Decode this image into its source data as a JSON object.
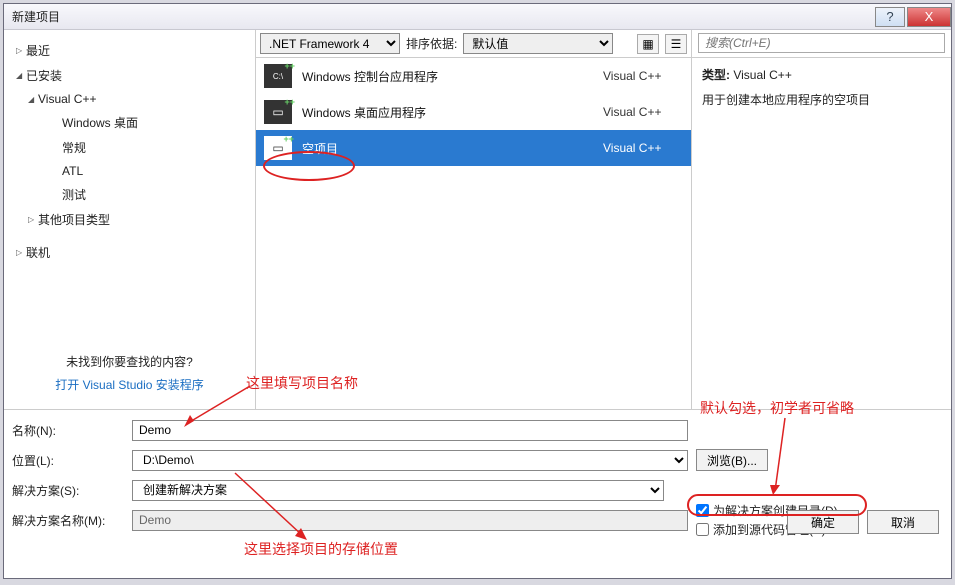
{
  "window_title": "新建项目",
  "titlebar": {
    "help": "?",
    "close": "X"
  },
  "tree": {
    "recent": "最近",
    "installed": "已安装",
    "vcpp": "Visual C++",
    "win_desktop": "Windows 桌面",
    "general": "常规",
    "atl": "ATL",
    "test": "测试",
    "other_types": "其他项目类型",
    "online": "联机"
  },
  "left_bottom": {
    "not_found": "未找到你要查找的内容?",
    "open_installer": "打开 Visual Studio 安装程序"
  },
  "toolbar": {
    "framework": ".NET Framework 4",
    "sort_label": "排序依据:",
    "sort_value": "默认值"
  },
  "templates": [
    {
      "name": "Windows 控制台应用程序",
      "lang": "Visual C++",
      "icon": "C:\\"
    },
    {
      "name": "Windows 桌面应用程序",
      "lang": "Visual C++",
      "icon": "▭"
    },
    {
      "name": "空项目",
      "lang": "Visual C++",
      "icon": "▭"
    }
  ],
  "search": {
    "placeholder": "搜索(Ctrl+E)"
  },
  "detail": {
    "type_label": "类型:",
    "type_value": "Visual C++",
    "description": "用于创建本地应用程序的空项目"
  },
  "form": {
    "name_label": "名称(N):",
    "name_value": "Demo",
    "loc_label": "位置(L):",
    "loc_value": "D:\\Demo\\",
    "browse": "浏览(B)...",
    "sln_label": "解决方案(S):",
    "sln_value": "创建新解决方案",
    "sln_name_label": "解决方案名称(M):",
    "sln_name_value": "Demo",
    "chk_dir": "为解决方案创建目录(D)",
    "chk_src": "添加到源代码管理(U)"
  },
  "buttons": {
    "ok": "确定",
    "cancel": "取消"
  },
  "annotations": {
    "a1": "这里填写项目名称",
    "a2": "默认勾选，初学者可省略",
    "a3": "这里选择项目的存储位置"
  }
}
